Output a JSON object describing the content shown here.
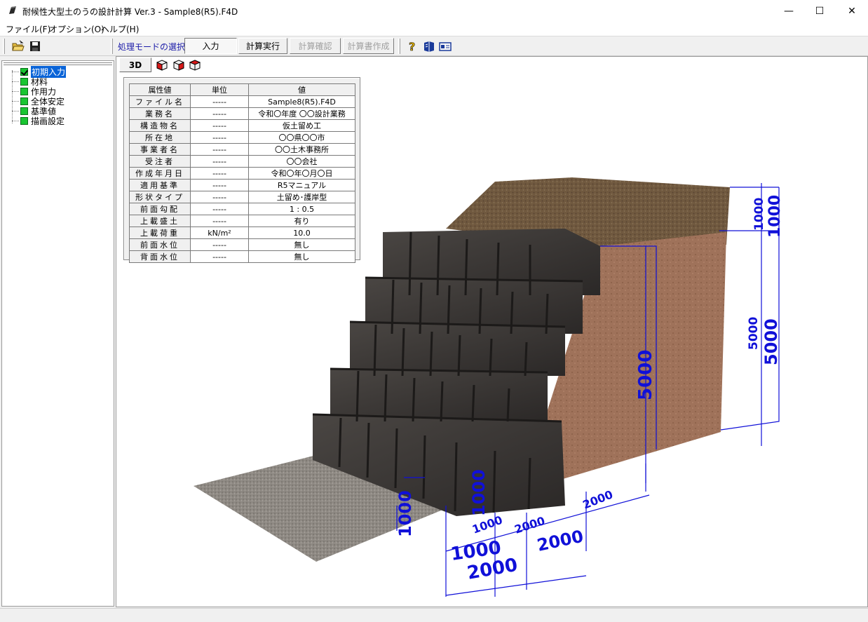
{
  "window": {
    "title": "耐候性大型土のうの設計計算 Ver.3 - Sample8(R5).F4D",
    "minimize": "—",
    "maximize": "☐",
    "close": "✕"
  },
  "menu": {
    "file": "ファイル(F)",
    "options": "オプション(O)",
    "help": "ヘルプ(H)"
  },
  "toolbar": {
    "mode_label": "処理モードの選択",
    "input": "入力",
    "run": "計算実行",
    "confirm": "計算確認",
    "report": "計算書作成"
  },
  "tree": {
    "items": [
      {
        "label": "初期入力",
        "checked": true,
        "selected": true
      },
      {
        "label": "材料"
      },
      {
        "label": "作用力"
      },
      {
        "label": "全体安定"
      },
      {
        "label": "基準値"
      },
      {
        "label": "描画設定"
      }
    ]
  },
  "view": {
    "btn_3d": "3D"
  },
  "table": {
    "headers": [
      "属性値",
      "単位",
      "値"
    ],
    "rows": [
      [
        "ファイル名",
        "-----",
        "Sample8(R5).F4D"
      ],
      [
        "業務名",
        "-----",
        "令和〇年度 〇〇設計業務"
      ],
      [
        "構造物名",
        "-----",
        "仮土留め工"
      ],
      [
        "所在地",
        "-----",
        "〇〇県〇〇市"
      ],
      [
        "事業者名",
        "-----",
        "〇〇土木事務所"
      ],
      [
        "受注者",
        "-----",
        "〇〇会社"
      ],
      [
        "作成年月日",
        "-----",
        "令和〇年〇月〇日"
      ],
      [
        "適用基準",
        "-----",
        "R5マニュアル"
      ],
      [
        "形状タイプ",
        "-----",
        "土留め･護岸型"
      ],
      [
        "前面勾配",
        "-----",
        "1 : 0.5"
      ],
      [
        "上載盛土",
        "-----",
        "有り"
      ],
      [
        "上載荷重",
        "kN/m²",
        "10.0"
      ],
      [
        "前面水位",
        "-----",
        "無し"
      ],
      [
        "背面水位",
        "-----",
        "無し"
      ]
    ]
  },
  "dimensions": {
    "top_1000_a": "1000",
    "top_1000_b": "1000",
    "right_5000_a": "5000",
    "right_5000_b": "5000",
    "mid_5000": "5000",
    "left_1000": "1000",
    "front_1000_a": "1000",
    "front_1000_b": "1000",
    "front_1000_c": "1000",
    "bottom_2000_a": "2000",
    "bottom_2000_b": "2000",
    "bottom_2000_c": "2000",
    "bottom_2000_d": "2000"
  },
  "colors": {
    "dimension_blue": "#1010d8",
    "block_dark": "#3a3634",
    "soil_brown": "#9c6f55",
    "topsoil": "#6e5a45",
    "gravel": "#8a8580",
    "selected_bg": "#0a64d8"
  }
}
